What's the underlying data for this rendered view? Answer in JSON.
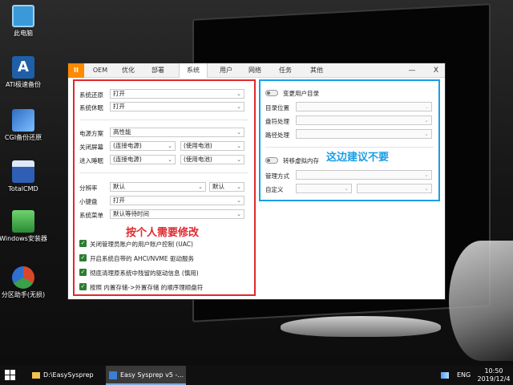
{
  "desktop": {
    "icons": [
      {
        "label": "此电脑",
        "icon": "computer-icon",
        "color": "#3a9ad9"
      },
      {
        "label": "ATI极速备份",
        "icon": "ati-backup-icon",
        "color": "#1f5fa8"
      },
      {
        "label": "CGI备份还原",
        "icon": "cgi-tools-icon",
        "color": "#2e6bc4"
      },
      {
        "label": "TotalCMD",
        "icon": "floppy-icon",
        "color": "#2f5fb4"
      },
      {
        "label": "Windows安装器",
        "icon": "installer-icon",
        "color": "#3aa04a"
      },
      {
        "label": "分区助手(无损)",
        "icon": "partition-icon",
        "color": "#d9472b"
      }
    ]
  },
  "app": {
    "logo": "II",
    "tabs": [
      "OEM",
      "优化",
      "部署",
      "系统",
      "用户",
      "网络",
      "任务",
      "其他"
    ],
    "active_tab": "系统",
    "minimize": "—",
    "close": "X",
    "left": {
      "restore_label": "系统还原",
      "restore_value": "打开",
      "hibernate_label": "系统休眠",
      "hibernate_value": "打开",
      "power_plan_label": "电源方案",
      "power_plan_value": "高性能",
      "screen_off_label": "关闭屏幕",
      "screen_off_ac": "(连接电源)",
      "screen_off_battery": "(使用电池)",
      "sleep_label": "进入睡眠",
      "sleep_ac": "(连接电源)",
      "sleep_battery": "(使用电池)",
      "resolution_label": "分辨率",
      "resolution_value": "默认",
      "resolution_scale": "默认",
      "keypad_label": "小键盘",
      "keypad_value": "打开",
      "menu_label": "系统菜单",
      "menu_value": "默认等待时间",
      "checks": [
        "关闭管理员账户的用户账户控制 (UAC)",
        "开启系统自带的 AHCI/NVME 驱动服务",
        "彻底清理原系统中残留的驱动信息 (慎用)",
        "按照 内置存储->外置存储 的顺序理顺盘符"
      ],
      "note": "按个人需要修改"
    },
    "right": {
      "profile_toggle_label": "变更用户目录",
      "dir_label": "目录位置",
      "dir_browse": "..",
      "drive_label": "盘符处理",
      "path_label": "路径处理",
      "pagefile_toggle_label": "转移虚拟内存",
      "manage_label": "管理方式",
      "custom_label": "自定义",
      "note": "这边建议不要"
    }
  },
  "taskbar": {
    "start_icon": "windows-start-icon",
    "explorer_label": "D:\\EasySysprep",
    "sysprep_label": "Easy Sysprep v5 -...",
    "lang": "ENG",
    "time": "10:50",
    "date": "2019/12/4"
  },
  "colors": {
    "accent_orange": "#ff8a00",
    "note_red": "#e0282e",
    "note_blue": "#1a9ee6",
    "check_green": "#2e7d32"
  }
}
